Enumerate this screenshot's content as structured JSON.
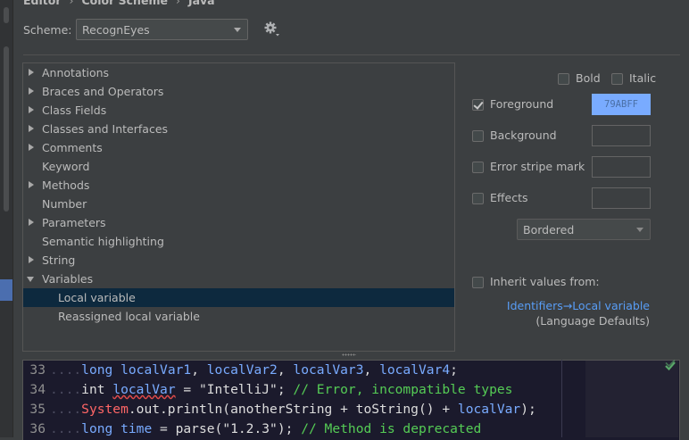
{
  "breadcrumb": [
    "Editor",
    "Color Scheme",
    "Java"
  ],
  "scheme": {
    "label": "Scheme:",
    "value": "RecognEyes"
  },
  "tree": {
    "items": [
      {
        "label": "Annotations",
        "expander": "collapsed"
      },
      {
        "label": "Braces and Operators",
        "expander": "collapsed"
      },
      {
        "label": "Class Fields",
        "expander": "collapsed"
      },
      {
        "label": "Classes and Interfaces",
        "expander": "collapsed"
      },
      {
        "label": "Comments",
        "expander": "collapsed"
      },
      {
        "label": "Keyword",
        "expander": "none"
      },
      {
        "label": "Methods",
        "expander": "collapsed"
      },
      {
        "label": "Number",
        "expander": "none"
      },
      {
        "label": "Parameters",
        "expander": "collapsed"
      },
      {
        "label": "Semantic highlighting",
        "expander": "none"
      },
      {
        "label": "String",
        "expander": "collapsed"
      },
      {
        "label": "Variables",
        "expander": "expanded"
      },
      {
        "label": "Local variable",
        "expander": "child",
        "selected": true
      },
      {
        "label": "Reassigned local variable",
        "expander": "child"
      }
    ]
  },
  "attributes": {
    "bold": {
      "label": "Bold",
      "checked": false
    },
    "italic": {
      "label": "Italic",
      "checked": false
    },
    "foreground": {
      "label": "Foreground",
      "checked": true,
      "color": "79ABFF"
    },
    "background": {
      "label": "Background",
      "checked": false
    },
    "error_stripe": {
      "label": "Error stripe mark",
      "checked": false
    },
    "effects": {
      "label": "Effects",
      "checked": false,
      "style": "Bordered"
    },
    "inherit": {
      "label": "Inherit values from:",
      "checked": false,
      "link": "Identifiers→Local variable",
      "source": "(Language Defaults)"
    }
  },
  "preview": {
    "lines": [
      {
        "num": "33",
        "text": "long localVar1, localVar2, localVar3, localVar4;"
      },
      {
        "num": "34",
        "text": "int localVar = \"IntelliJ\"; // Error, incompatible types"
      },
      {
        "num": "35",
        "text": "System.out.println(anotherString + toString() + localVar);"
      },
      {
        "num": "36",
        "text": "long time = parse(\"1.2.3\"); // Method is deprecated"
      }
    ]
  },
  "colors": {
    "background": "#3c3f41",
    "selection": "#0d293e",
    "foreground_swatch": "#79ABFF",
    "link": "#589df6",
    "editor_background": "#1b1a2c",
    "comment": "#55cc55",
    "error": "#ff6666"
  },
  "icons": [
    "gear-icon",
    "check-icon",
    "chevron-right-icon",
    "chevron-down-icon"
  ]
}
